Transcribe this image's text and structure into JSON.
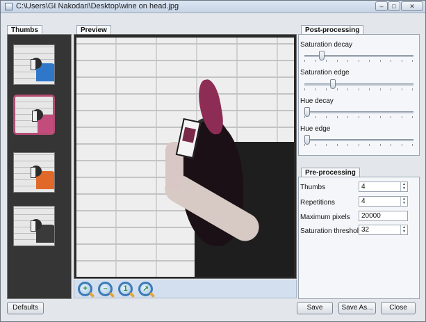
{
  "window": {
    "title": "C:\\Users\\GI Nakodari\\Desktop\\wine on head.jpg"
  },
  "titlebar_buttons": {
    "minimize": "–",
    "maximize": "□",
    "close": "✕"
  },
  "panels": {
    "thumbs": {
      "tab": "Thumbs"
    },
    "preview": {
      "tab": "Preview"
    },
    "post_processing": {
      "tab": "Post-processing",
      "sliders": [
        {
          "label": "Saturation decay",
          "value": 0.14
        },
        {
          "label": "Saturation edge",
          "value": 0.25
        },
        {
          "label": "Hue decay",
          "value": 0.0
        },
        {
          "label": "Hue edge",
          "value": 0.0
        }
      ]
    },
    "pre_processing": {
      "tab": "Pre-processing",
      "fields": [
        {
          "label": "Thumbs",
          "value": "4",
          "type": "spin"
        },
        {
          "label": "Repetitions",
          "value": "4",
          "type": "spin"
        },
        {
          "label": "Maximum pixels",
          "value": "20000",
          "type": "text"
        },
        {
          "label": "Saturation threshold",
          "value": "32",
          "type": "spin"
        }
      ]
    }
  },
  "thumbnails": [
    {
      "color": "#2f78c9"
    },
    {
      "color": "#c24d7c",
      "selected": true
    },
    {
      "color": "#e0692a"
    },
    {
      "color": "#3a3a3a"
    }
  ],
  "zoom_buttons": [
    {
      "name": "zoom-in-icon",
      "glyph": "+"
    },
    {
      "name": "zoom-out-icon",
      "glyph": "–"
    },
    {
      "name": "zoom-actual-icon",
      "glyph": "1"
    },
    {
      "name": "zoom-fit-icon",
      "glyph": "↗"
    }
  ],
  "buttons": {
    "defaults": "Defaults",
    "save": "Save",
    "save_as": "Save As...",
    "close": "Close"
  }
}
